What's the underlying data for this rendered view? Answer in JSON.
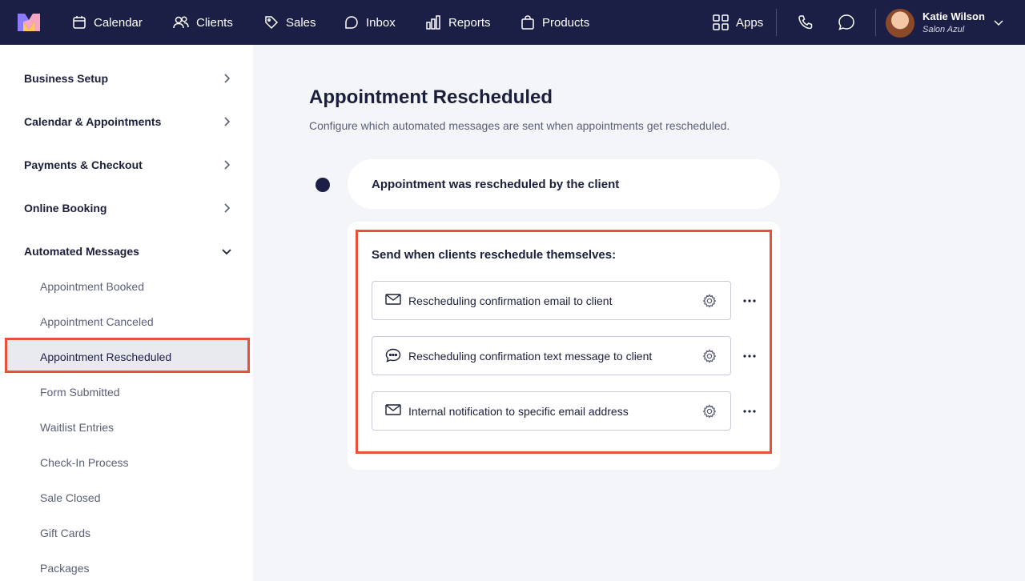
{
  "nav": {
    "items": [
      {
        "label": "Calendar",
        "icon": "calendar-icon"
      },
      {
        "label": "Clients",
        "icon": "clients-icon"
      },
      {
        "label": "Sales",
        "icon": "tag-icon"
      },
      {
        "label": "Inbox",
        "icon": "inbox-icon"
      },
      {
        "label": "Reports",
        "icon": "reports-icon"
      },
      {
        "label": "Products",
        "icon": "bag-icon"
      }
    ],
    "apps_label": "Apps",
    "user": {
      "name": "Katie Wilson",
      "salon": "Salon Azul"
    }
  },
  "sidebar": {
    "sections": [
      {
        "label": "Business Setup",
        "expanded": false
      },
      {
        "label": "Calendar & Appointments",
        "expanded": false
      },
      {
        "label": "Payments & Checkout",
        "expanded": false
      },
      {
        "label": "Online Booking",
        "expanded": false
      },
      {
        "label": "Automated Messages",
        "expanded": true
      }
    ],
    "subitems": [
      {
        "label": "Appointment Booked"
      },
      {
        "label": "Appointment Canceled"
      },
      {
        "label": "Appointment Rescheduled",
        "active": true
      },
      {
        "label": "Form Submitted"
      },
      {
        "label": "Waitlist Entries"
      },
      {
        "label": "Check-In Process"
      },
      {
        "label": "Sale Closed"
      },
      {
        "label": "Gift Cards"
      },
      {
        "label": "Packages"
      }
    ]
  },
  "main": {
    "title": "Appointment Rescheduled",
    "description": "Configure which automated messages are sent when appointments get rescheduled.",
    "trigger": "Appointment was rescheduled by the client",
    "card_heading": "Send when clients reschedule themselves:",
    "messages": [
      {
        "label": "Rescheduling confirmation email to client",
        "icon": "envelope-icon"
      },
      {
        "label": "Rescheduling confirmation text message to client",
        "icon": "chat-bubble-icon"
      },
      {
        "label": "Internal notification to specific email address",
        "icon": "envelope-icon"
      }
    ]
  },
  "colors": {
    "nav_bg": "#1c1f45",
    "highlight": "#e8503a",
    "page_bg": "#f4f5f8"
  }
}
